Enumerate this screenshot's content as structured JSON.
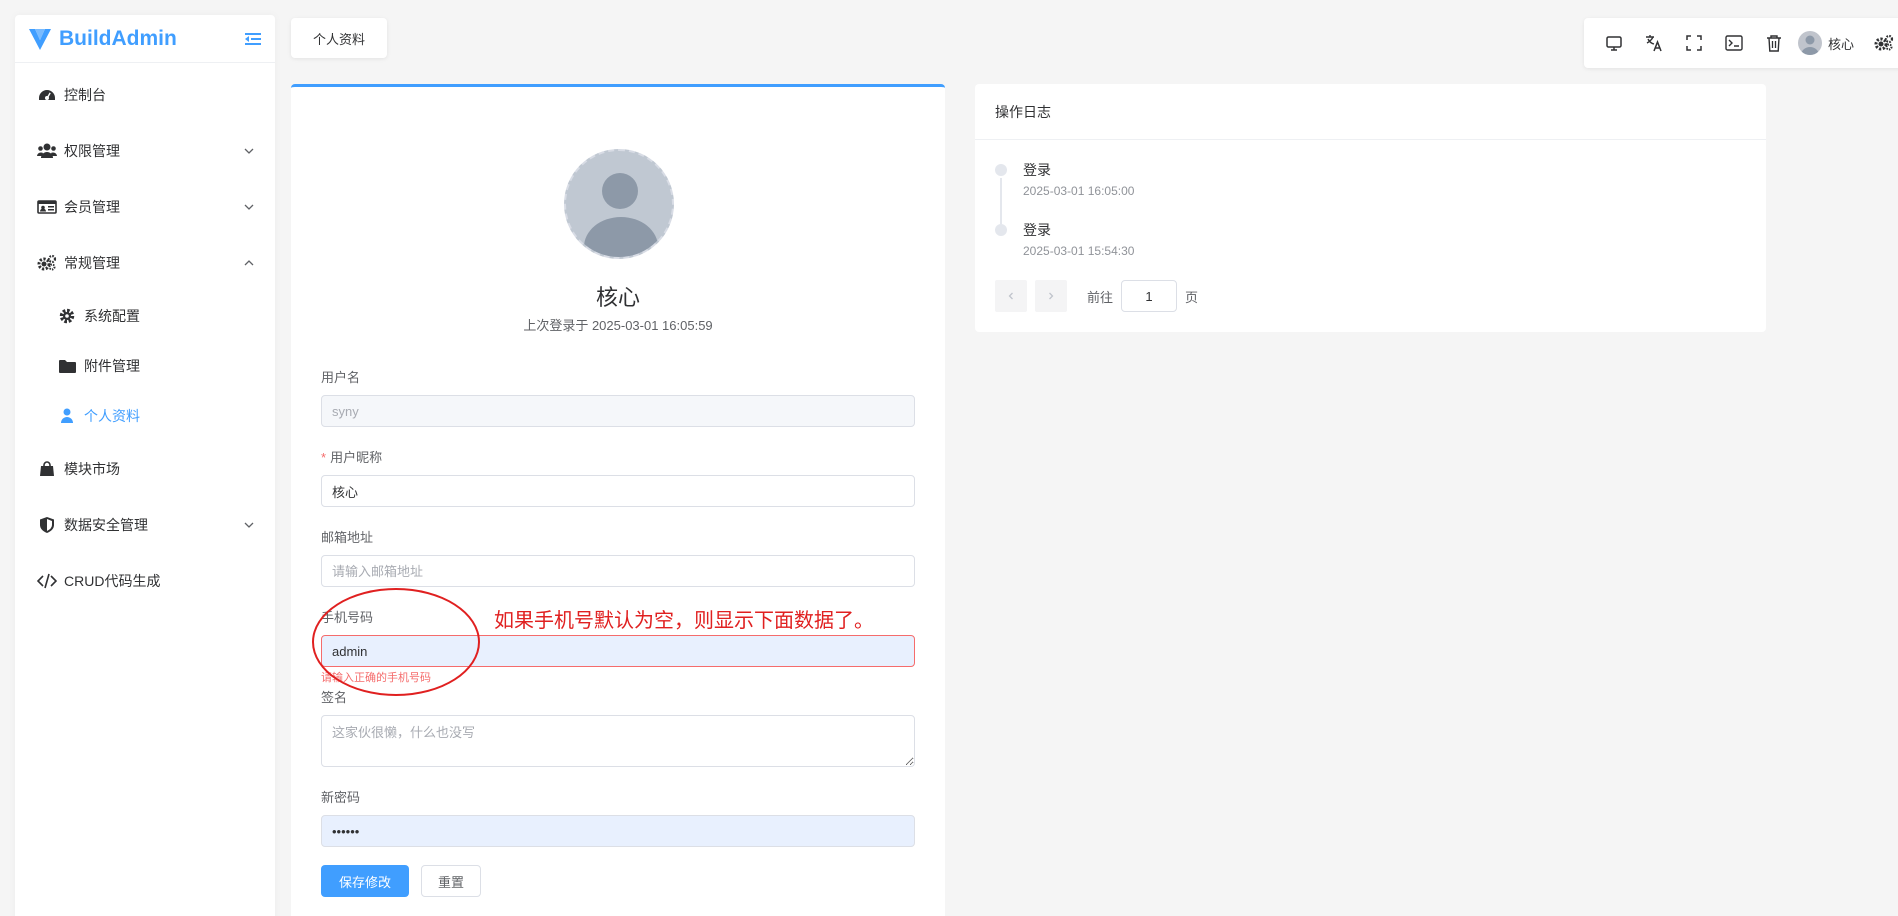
{
  "brand": {
    "name": "BuildAdmin",
    "accent": "#409eff"
  },
  "sidebar": {
    "items": [
      {
        "label": "控制台",
        "icon": "dashboard-icon"
      },
      {
        "label": "权限管理",
        "icon": "users-icon",
        "expandable": true
      },
      {
        "label": "会员管理",
        "icon": "id-card-icon",
        "expandable": true
      },
      {
        "label": "常规管理",
        "icon": "gears-icon",
        "expanded": true
      },
      {
        "label": "系统配置",
        "icon": "gear-icon",
        "sub": true
      },
      {
        "label": "附件管理",
        "icon": "folder-icon",
        "sub": true
      },
      {
        "label": "个人资料",
        "icon": "user-icon",
        "sub": true,
        "active": true
      },
      {
        "label": "模块市场",
        "icon": "shopping-bag-icon"
      },
      {
        "label": "数据安全管理",
        "icon": "shield-icon",
        "expandable": true
      },
      {
        "label": "CRUD代码生成",
        "icon": "code-icon"
      }
    ]
  },
  "tabs": [
    {
      "label": "个人资料"
    }
  ],
  "toolbar": {
    "icons": [
      "monitor-icon",
      "translate-icon",
      "fullscreen-icon",
      "terminal-icon",
      "trash-icon",
      "settings-icon"
    ],
    "user_name": "核心"
  },
  "profile": {
    "nickname": "核心",
    "last_login": "上次登录于 2025-03-01 16:05:59",
    "fields": {
      "username": {
        "label": "用户名",
        "value": "syny"
      },
      "nickname": {
        "label": "用户昵称",
        "value": "核心",
        "required": "*"
      },
      "email": {
        "label": "邮箱地址",
        "value": "",
        "placeholder": "请输入邮箱地址"
      },
      "mobile": {
        "label": "手机号码",
        "value": "admin",
        "error": "请输入正确的手机号码"
      },
      "signature": {
        "label": "签名",
        "value": "",
        "placeholder": "这家伙很懒，什么也没写"
      },
      "password": {
        "label": "新密码",
        "value": "••••••"
      }
    },
    "save_label": "保存修改",
    "reset_label": "重置"
  },
  "annotation": {
    "text": "如果手机号默认为空，则显示下面数据了。",
    "color": "#e02020"
  },
  "log": {
    "title": "操作日志",
    "entries": [
      {
        "title": "登录",
        "time": "2025-03-01 16:05:00"
      },
      {
        "title": "登录",
        "time": "2025-03-01 15:54:30"
      }
    ],
    "pager": {
      "goto_label": "前往",
      "page": "1",
      "page_unit": "页"
    }
  }
}
